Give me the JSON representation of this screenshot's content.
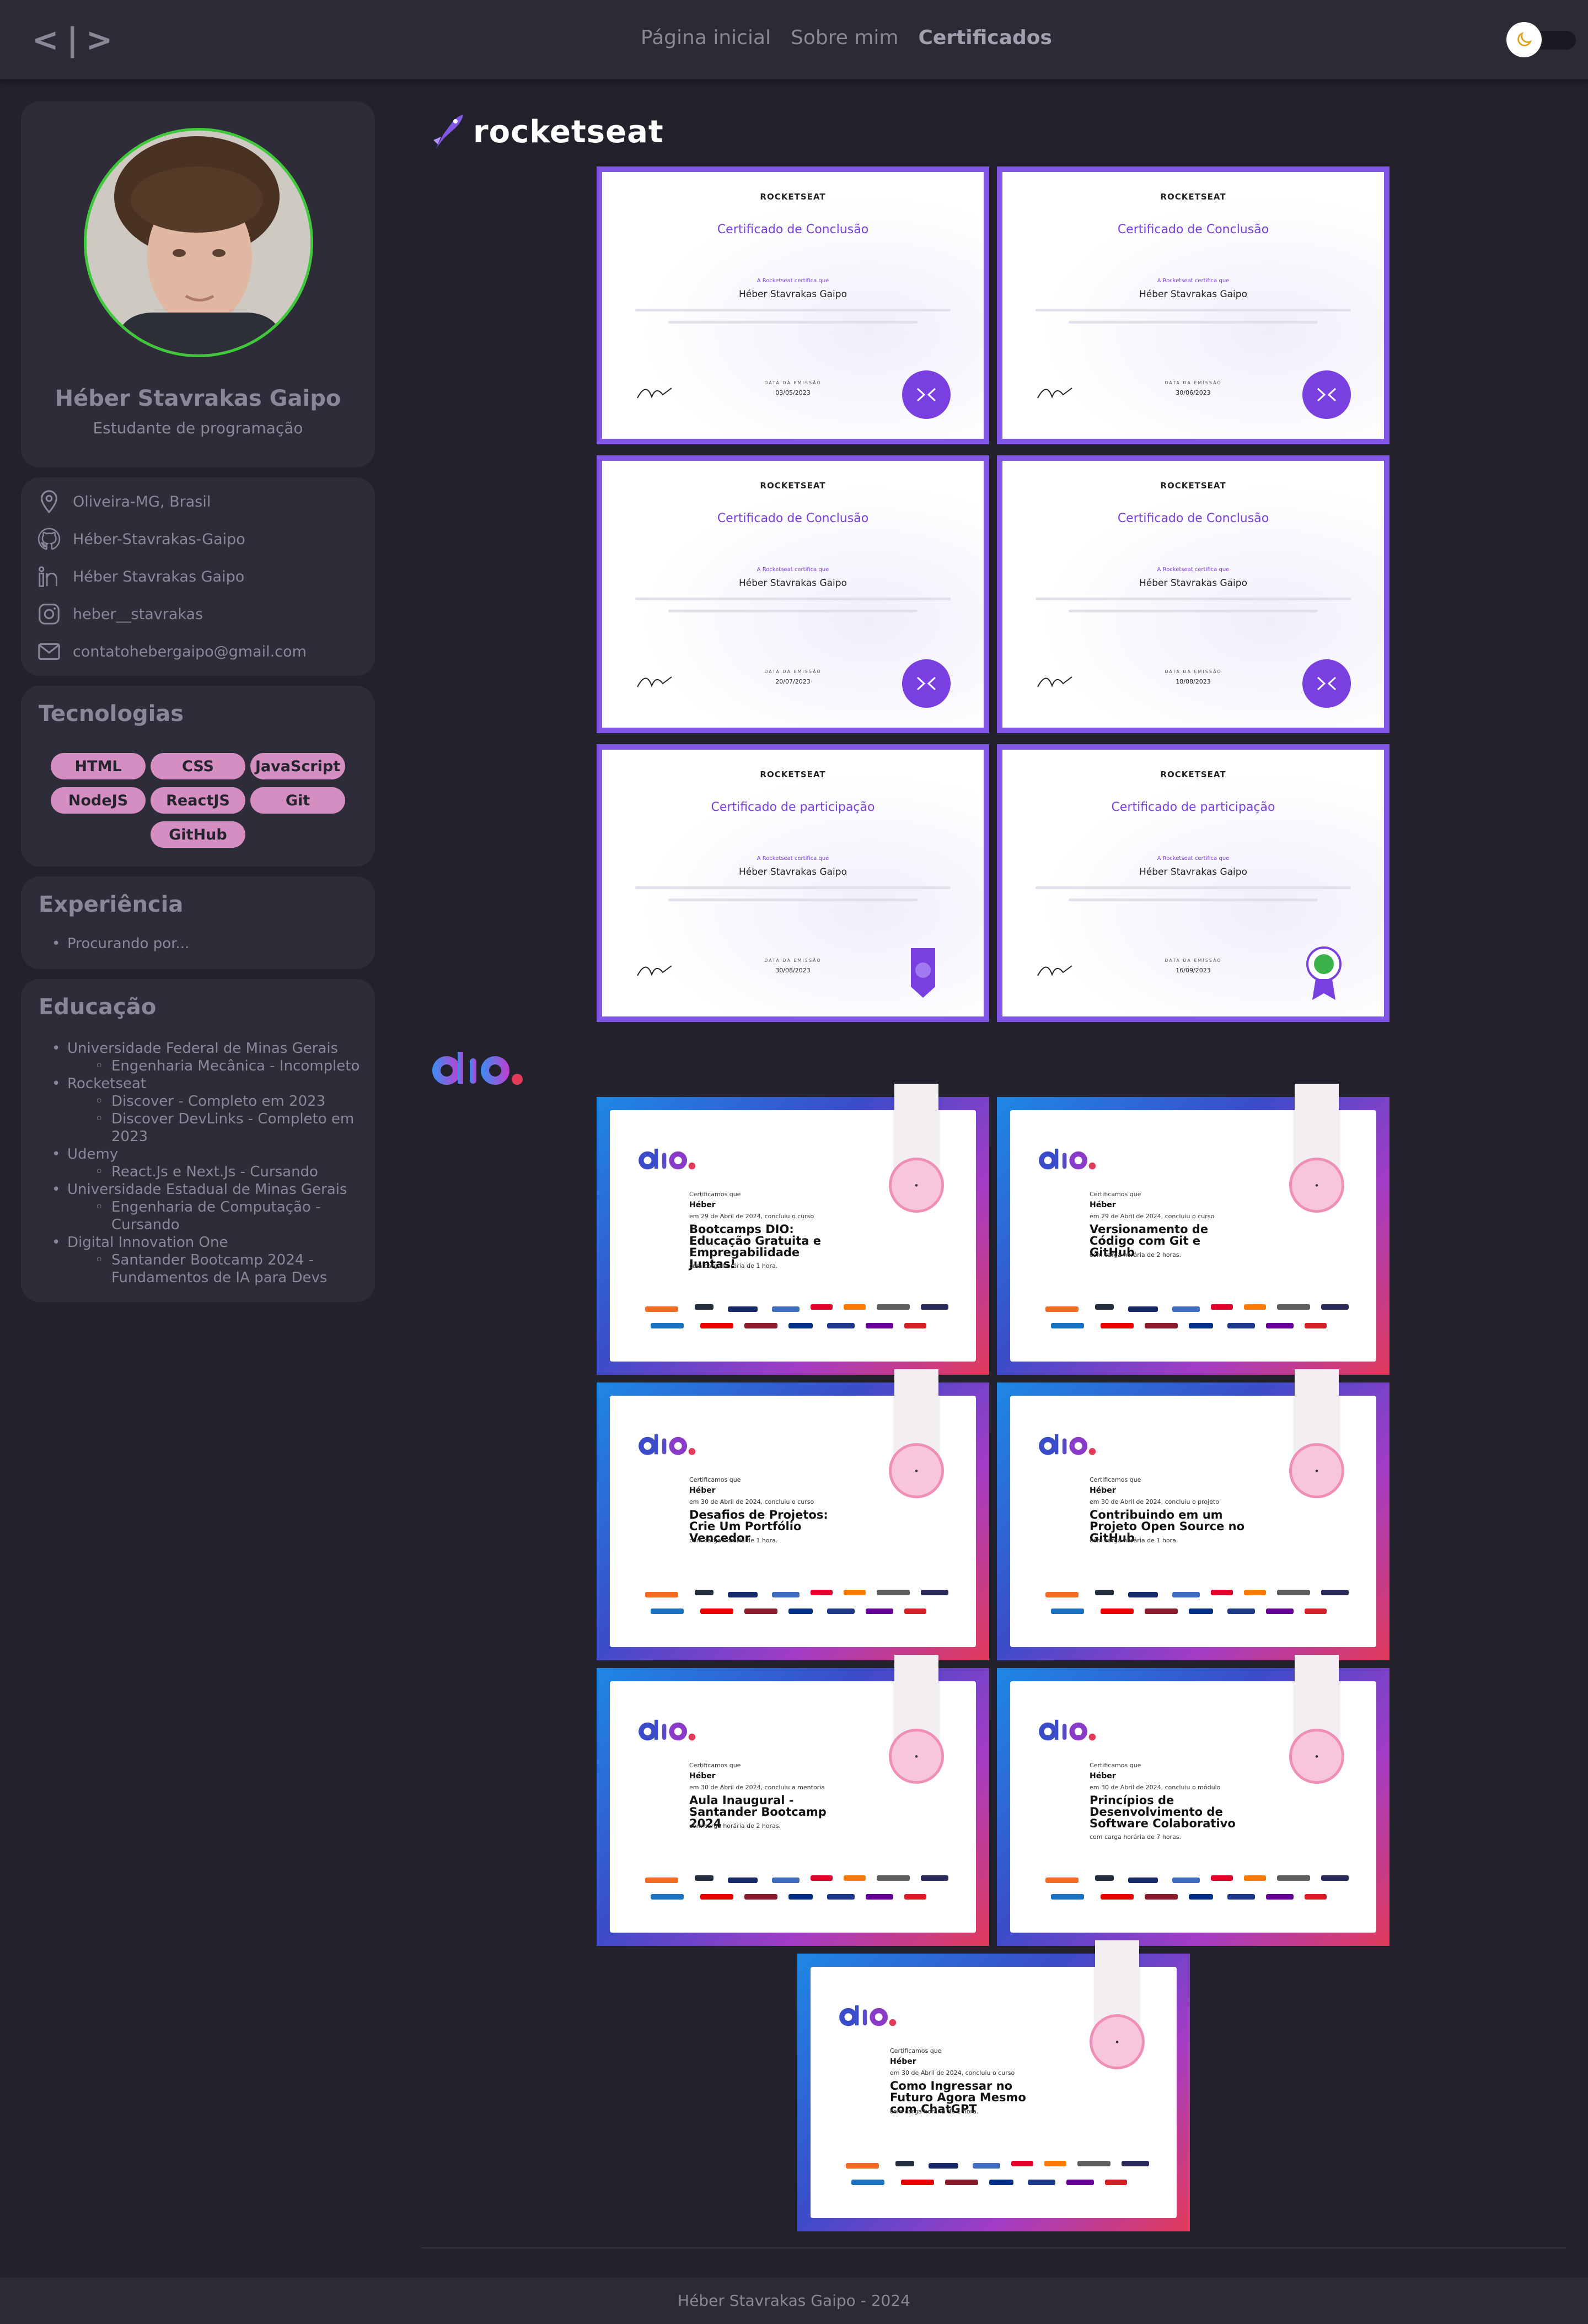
{
  "nav": {
    "logo": "<|>",
    "links": [
      "Página inicial",
      "Sobre mim",
      "Certificados"
    ],
    "active": "Certificados",
    "theme_toggle_icon": "moon-icon"
  },
  "profile": {
    "name": "Héber Stavrakas Gaipo",
    "role": "Estudante de programação",
    "accent_color": "#3fc83a"
  },
  "contacts": [
    {
      "icon": "location-icon",
      "text": "Oliveira-MG, Brasil"
    },
    {
      "icon": "github-icon",
      "text": "Héber-Stavrakas-Gaipo"
    },
    {
      "icon": "linkedin-icon",
      "text": "Héber Stavrakas Gaipo"
    },
    {
      "icon": "instagram-icon",
      "text": "heber__stavrakas"
    },
    {
      "icon": "mail-icon",
      "text": "contatohebergaipo@gmail.com"
    }
  ],
  "technologies": {
    "title": "Tecnologias",
    "items": [
      "HTML",
      "CSS",
      "JavaScript",
      "NodeJS",
      "ReactJS",
      "Git",
      "GitHub"
    ],
    "pill_color": "#d48ec1"
  },
  "experience": {
    "title": "Experiência",
    "items": [
      "Procurando por..."
    ]
  },
  "education": {
    "title": "Educação",
    "items": [
      {
        "name": "Universidade Federal de Minas Gerais",
        "children": [
          "Engenharia Mecânica - Incompleto"
        ]
      },
      {
        "name": "Rocketseat",
        "children": [
          "Discover - Completo em 2023",
          "Discover DevLinks - Completo em 2023"
        ]
      },
      {
        "name": "Udemy",
        "children": [
          "React.Js e Next.Js - Cursando"
        ]
      },
      {
        "name": "Universidade Estadual de Minas Gerais",
        "children": [
          "Engenharia de Computação - Cursando"
        ]
      },
      {
        "name": "Digital Innovation One",
        "children": [
          "Santander Bootcamp 2024 - Fundamentos de IA para Devs"
        ]
      }
    ]
  },
  "rocketseat": {
    "logo_text": "rocketseat",
    "brand_color": "#8257e5",
    "certificates": [
      {
        "brand": "ROCKETSEAT",
        "title": "Certificado de Conclusão",
        "intro": "A Rocketseat certifica que",
        "name": "Héber Stavrakas Gaipo",
        "date_label": "DATA DA EMISSÃO",
        "date": "03/05/2023"
      },
      {
        "brand": "ROCKETSEAT",
        "title": "Certificado de Conclusão",
        "intro": "A Rocketseat certifica que",
        "name": "Héber Stavrakas Gaipo",
        "date_label": "DATA DA EMISSÃO",
        "date": "30/06/2023"
      },
      {
        "brand": "ROCKETSEAT",
        "title": "Certificado de Conclusão",
        "intro": "A Rocketseat certifica que",
        "name": "Héber Stavrakas Gaipo",
        "date_label": "DATA DA EMISSÃO",
        "date": "20/07/2023"
      },
      {
        "brand": "ROCKETSEAT",
        "title": "Certificado de Conclusão",
        "intro": "A Rocketseat certifica que",
        "name": "Héber Stavrakas Gaipo",
        "date_label": "DATA DA EMISSÃO",
        "date": "18/08/2023"
      },
      {
        "brand": "ROCKETSEAT",
        "title": "Certificado de participação",
        "intro": "A Rocketseat certifica que",
        "name": "Héber Stavrakas Gaipo",
        "date_label": "DATA DA EMISSÃO",
        "date": "30/08/2023"
      },
      {
        "brand": "ROCKETSEAT",
        "title": "Certificado de participação",
        "intro": "A Rocketseat certifica que",
        "name": "Héber Stavrakas Gaipo",
        "date_label": "DATA DA EMISSÃO",
        "date": "16/09/2023"
      }
    ]
  },
  "dio": {
    "logo_text": "dio.",
    "certificates": [
      {
        "intro": "Certificamos que",
        "name": "Héber",
        "date_line": "em 29 de Abril de 2024, concluiu o curso",
        "title": "Bootcamps DIO: Educação Gratuita e Empregabilidade Juntas!",
        "hours": "com carga horária de 1 hora."
      },
      {
        "intro": "Certificamos que",
        "name": "Héber",
        "date_line": "em 29 de Abril de 2024, concluiu o curso",
        "title": "Versionamento de Código com Git e GitHub",
        "hours": "com carga horária de 2 horas."
      },
      {
        "intro": "Certificamos que",
        "name": "Héber",
        "date_line": "em 30 de Abril de 2024, concluiu o curso",
        "title": "Desafios de Projetos: Crie Um Portfólio Vencedor",
        "hours": "com carga horária de 1 hora."
      },
      {
        "intro": "Certificamos que",
        "name": "Héber",
        "date_line": "em 30 de Abril de 2024, concluiu o projeto",
        "title": "Contribuindo em um Projeto Open Source no GitHub",
        "hours": "com carga horária de 1 hora."
      },
      {
        "intro": "Certificamos que",
        "name": "Héber",
        "date_line": "em 30 de Abril de 2024, concluiu a mentoria",
        "title": "Aula Inaugural - Santander Bootcamp 2024",
        "hours": "com carga horária de 2 horas."
      },
      {
        "intro": "Certificamos que",
        "name": "Héber",
        "date_line": "em 30 de Abril de 2024, concluiu o módulo",
        "title": "Princípios de Desenvolvimento de Software Colaborativo",
        "hours": "com carga horária de 7 horas."
      },
      {
        "intro": "Certificamos que",
        "name": "Héber",
        "date_line": "em 30 de Abril de 2024, concluiu o curso",
        "title": "Como Ingressar no Futuro Agora Mesmo com ChatGPT",
        "hours": "com carga horária de 1 hora."
      }
    ]
  },
  "footer": {
    "text": "Héber Stavrakas Gaipo - 2024"
  }
}
